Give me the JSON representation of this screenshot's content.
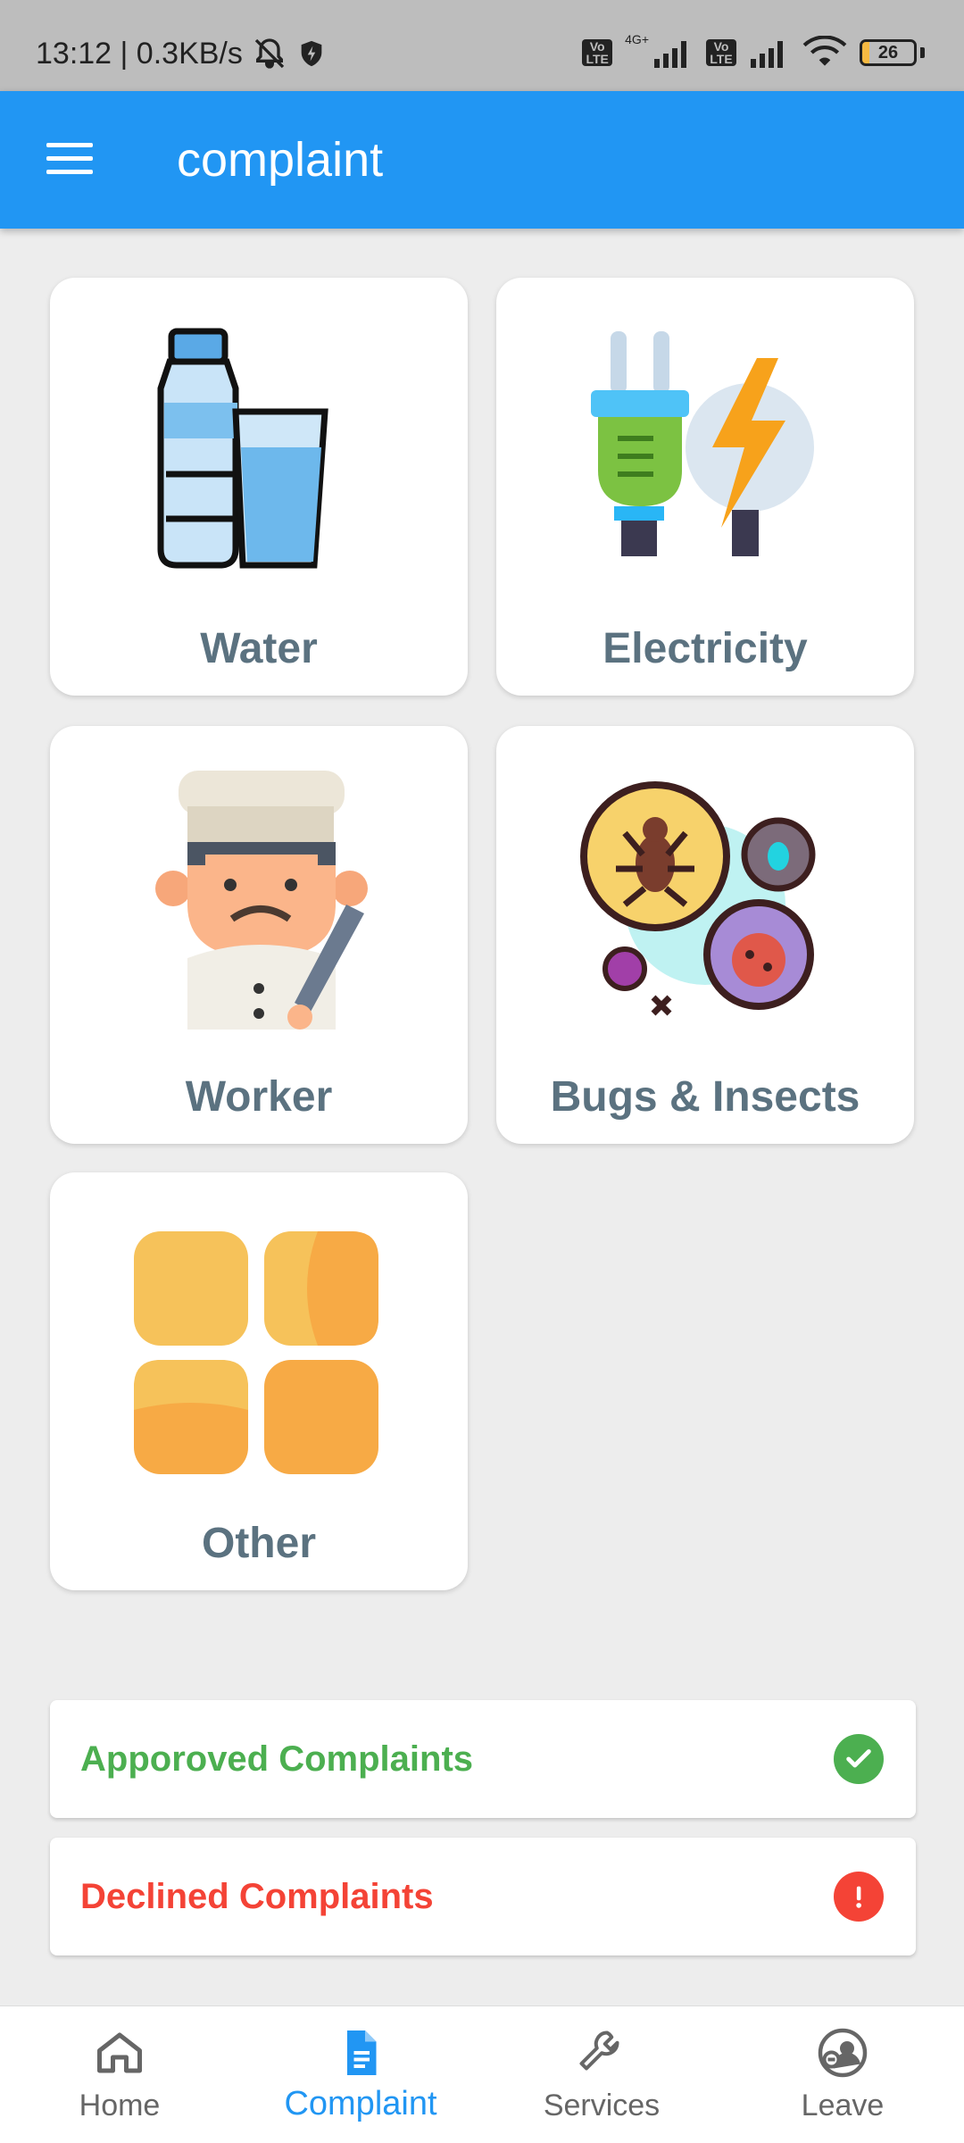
{
  "status_bar": {
    "time_speed": "13:12 | 0.3KB/s",
    "network_4g": "4G+",
    "volte_1": "Vo LTE",
    "volte_2": "Vo LTE",
    "battery": "26"
  },
  "app_bar": {
    "title": "complaint",
    "menu_icon": "hamburger-menu-icon",
    "color": "#2196f3"
  },
  "categories": [
    {
      "label": "Water",
      "icon": "water-bottle-glass-icon"
    },
    {
      "label": "Electricity",
      "icon": "plug-lightning-icon"
    },
    {
      "label": "Worker",
      "icon": "chef-worker-icon"
    },
    {
      "label": "Bugs & Insects",
      "icon": "bugs-insects-icon"
    },
    {
      "label": "Other",
      "icon": "four-squares-icon"
    }
  ],
  "status_rows": {
    "approved": {
      "label": "Apporoved Complaints",
      "color": "#4caf50",
      "icon": "check-circle-icon"
    },
    "declined": {
      "label": "Declined Complaints",
      "color": "#f44336",
      "icon": "exclamation-circle-icon"
    }
  },
  "bottom_nav": {
    "active": "Complaint",
    "active_color": "#2196f3",
    "items": [
      {
        "label": "Home",
        "icon": "home-icon"
      },
      {
        "label": "Complaint",
        "icon": "document-icon"
      },
      {
        "label": "Services",
        "icon": "wrench-icon"
      },
      {
        "label": "Leave",
        "icon": "user-minus-icon"
      }
    ]
  }
}
